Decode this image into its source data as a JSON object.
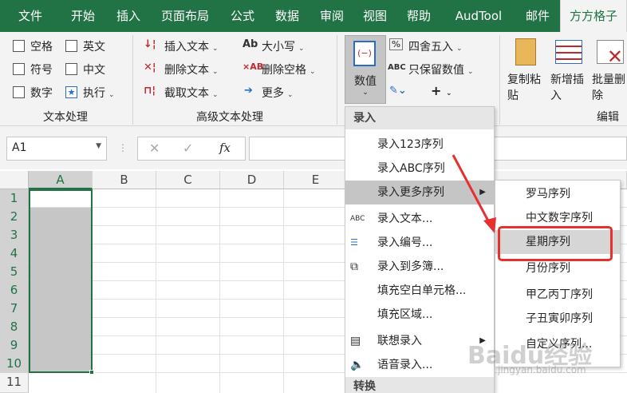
{
  "tabs": [
    {
      "label": "文件",
      "active": false
    },
    {
      "label": "开始",
      "active": false
    },
    {
      "label": "插入",
      "active": false
    },
    {
      "label": "页面布局",
      "active": false
    },
    {
      "label": "公式",
      "active": false
    },
    {
      "label": "数据",
      "active": false
    },
    {
      "label": "审阅",
      "active": false
    },
    {
      "label": "视图",
      "active": false
    },
    {
      "label": "帮助",
      "active": false
    },
    {
      "label": "AudTool",
      "active": false
    },
    {
      "label": "邮件",
      "active": false
    },
    {
      "label": "方方格子",
      "active": true
    }
  ],
  "ribbon": {
    "text_group": {
      "label": "文本处理",
      "items": [
        "空格",
        "英文",
        "符号",
        "中文",
        "数字",
        "执行"
      ]
    },
    "adv_group": {
      "label": "高级文本处理",
      "items": [
        "插入文本",
        "删除文本",
        "截取文本",
        "大小写",
        "删除空格",
        "更多"
      ]
    },
    "value_button": "数值",
    "value_items": [
      "四舍五入",
      "只保留数值"
    ],
    "edit_group": {
      "label": "编辑",
      "items": [
        "复制粘贴",
        "新增插入",
        "批量删除"
      ]
    }
  },
  "formula_bar": {
    "name_box": "A1",
    "fx": "fx",
    "value": ""
  },
  "columns": [
    "A",
    "B",
    "C",
    "D",
    "E"
  ],
  "rows": [
    "1",
    "2",
    "3",
    "4",
    "5",
    "6",
    "7",
    "8",
    "9",
    "10",
    "11"
  ],
  "menu": {
    "header1": "录入",
    "items": [
      {
        "label": "录入123序列",
        "icon": ""
      },
      {
        "label": "录入ABC序列",
        "icon": ""
      },
      {
        "label": "录入更多序列",
        "icon": "",
        "highlighted": true,
        "submenu": true
      },
      {
        "label": "录入文本...",
        "icon": "ABC"
      },
      {
        "label": "录入编号...",
        "icon": "list-number-icon"
      },
      {
        "label": "录入到多簿...",
        "icon": "copy-icon"
      },
      {
        "label": "填充空白单元格...",
        "icon": ""
      },
      {
        "label": "填充区域...",
        "icon": ""
      },
      {
        "label": "联想录入",
        "icon": "book-icon",
        "submenu": true
      },
      {
        "label": "语音录入...",
        "icon": "speaker-icon"
      }
    ],
    "header2": "转换"
  },
  "submenu": {
    "items": [
      "罗马序列",
      "中文数字序列",
      "星期序列",
      "月份序列",
      "甲乙丙丁序列",
      "子丑寅卯序列",
      "自定义序列..."
    ],
    "highlighted_index": 2
  },
  "watermark": {
    "main": "Baidu经验",
    "sub": "jingyan.baidu.com"
  },
  "colors": {
    "excel_green": "#217346",
    "highlight_red": "#e63030"
  }
}
